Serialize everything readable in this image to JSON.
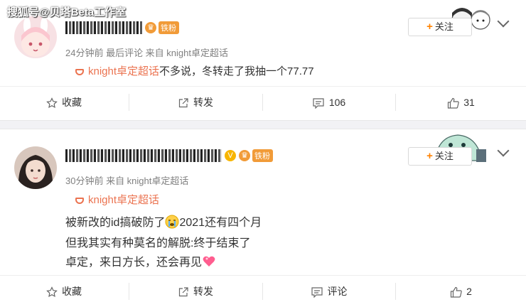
{
  "watermark": "搜狐号@贝塔Beta工作室",
  "posts": [
    {
      "badge": "铁粉",
      "meta": "24分钟前 最后评论 来自 knight卓定超话",
      "topic": "knight卓定超话",
      "text_lines": [
        "不多说，冬转走了我抽一个77.77"
      ],
      "follow_label": "关注",
      "actions": {
        "favorite": "收藏",
        "repost": "转发",
        "comment": "106",
        "like": "31"
      }
    },
    {
      "badge": "铁粉",
      "meta": "30分钟前 来自 knight卓定超话",
      "topic": "knight卓定超话",
      "text_lines": [
        "被新改的id搞破防了",
        "2021还有四个月",
        "但我其实有种莫名的解脱:终于结束了",
        "卓定，来日方长，还会再见"
      ],
      "follow_label": "关注",
      "actions": {
        "favorite": "收藏",
        "repost": "转发",
        "comment": "评论",
        "like": "2"
      }
    }
  ],
  "colors": {
    "topic": "#eb7350",
    "follow_plus": "#ff8200",
    "fan_badge": "#f19b38"
  }
}
